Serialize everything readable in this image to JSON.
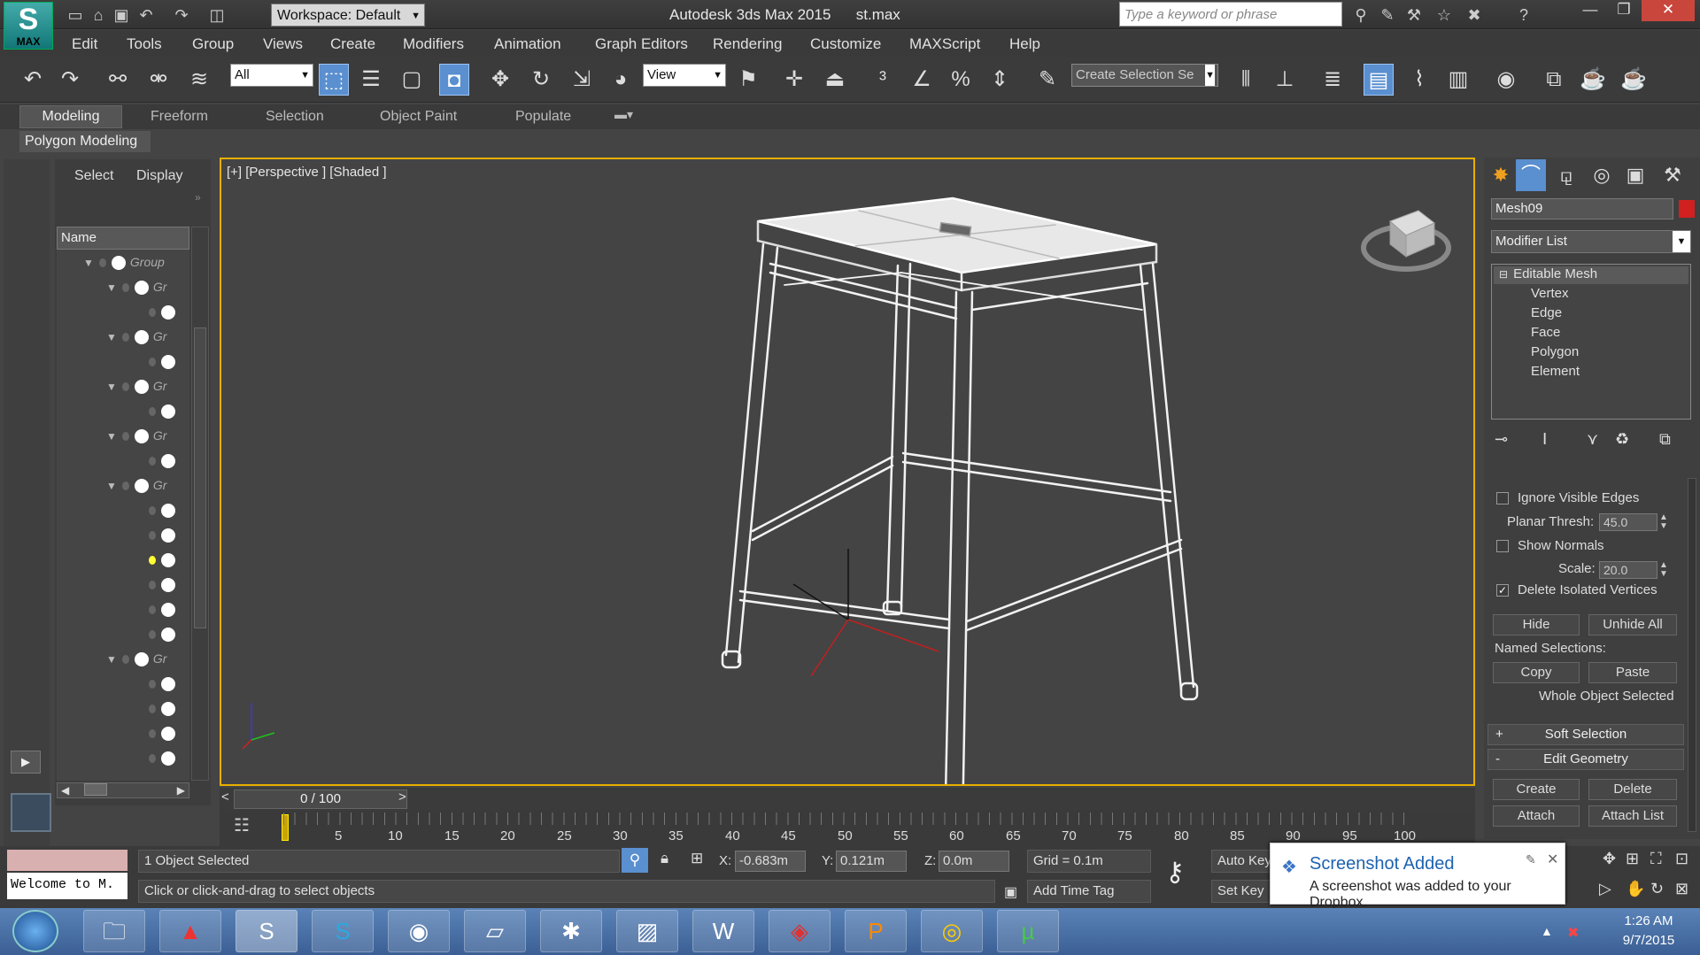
{
  "window": {
    "title": "Autodesk 3ds Max 2015",
    "file": "st.max",
    "workspace": "Workspace: Default",
    "search_placeholder": "Type a keyword or phrase",
    "logo_text": "MAX"
  },
  "menu": [
    "Edit",
    "Tools",
    "Group",
    "Views",
    "Create",
    "Modifiers",
    "Animation",
    "Graph Editors",
    "Rendering",
    "Customize",
    "MAXScript",
    "Help"
  ],
  "toolbar": {
    "filter": "All",
    "ref_coord": "View",
    "selection_set_placeholder": "Create Selection Se"
  },
  "ribbon": {
    "tabs": [
      "Modeling",
      "Freeform",
      "Selection",
      "Object Paint",
      "Populate"
    ],
    "active_tab": "Modeling",
    "panel_label": "Polygon Modeling"
  },
  "scene_explorer": {
    "tabs": [
      "Select",
      "Display"
    ],
    "column": "Name",
    "rows": [
      {
        "label": "Group",
        "level": 0
      },
      {
        "label": "Gr",
        "level": 1
      },
      {
        "label": "",
        "level": 2
      },
      {
        "label": "Gr",
        "level": 1
      },
      {
        "label": "",
        "level": 2
      },
      {
        "label": "Gr",
        "level": 1
      },
      {
        "label": "",
        "level": 2
      },
      {
        "label": "Gr",
        "level": 1
      },
      {
        "label": "",
        "level": 2
      },
      {
        "label": "Gr",
        "level": 1
      },
      {
        "label": "",
        "level": 2
      },
      {
        "label": "",
        "level": 2
      },
      {
        "label": "",
        "level": 2
      },
      {
        "label": "",
        "level": 2
      },
      {
        "label": "",
        "level": 2
      },
      {
        "label": "",
        "level": 2
      },
      {
        "label": "Gr",
        "level": 1
      },
      {
        "label": "",
        "level": 2
      },
      {
        "label": "",
        "level": 2
      },
      {
        "label": "",
        "level": 2
      },
      {
        "label": "",
        "level": 2
      }
    ]
  },
  "viewport": {
    "label": "[+] [Perspective ] [Shaded ]"
  },
  "command_panel": {
    "object_name": "Mesh09",
    "object_color": "#d02020",
    "modifier_list": "Modifier List",
    "stack": {
      "base": "Editable Mesh",
      "subs": [
        "Vertex",
        "Edge",
        "Face",
        "Polygon",
        "Element"
      ]
    },
    "ignore_visible_edges": "Ignore Visible Edges",
    "planar_thresh_label": "Planar Thresh:",
    "planar_thresh": "45.0",
    "show_normals": "Show Normals",
    "scale_label": "Scale:",
    "scale": "20.0",
    "delete_isolated": "Delete Isolated Vertices",
    "hide": "Hide",
    "unhide_all": "Unhide All",
    "named_selections": "Named Selections:",
    "copy": "Copy",
    "paste": "Paste",
    "whole_object": "Whole Object Selected",
    "soft_selection": "Soft Selection",
    "edit_geometry": "Edit Geometry",
    "create": "Create",
    "delete": "Delete",
    "attach": "Attach",
    "attach_list": "Attach List"
  },
  "timeline": {
    "frame": "0 / 100",
    "ticks": [
      "5",
      "10",
      "15",
      "20",
      "25",
      "30",
      "35",
      "40",
      "45",
      "50",
      "55",
      "60",
      "65",
      "70",
      "75",
      "80",
      "85",
      "90",
      "95",
      "100"
    ]
  },
  "status": {
    "listener": "Welcome to M.",
    "selected": "1 Object Selected",
    "prompt": "Click or click-and-drag to select objects",
    "x_label": "X:",
    "x": "-0.683m",
    "y_label": "Y:",
    "y": "0.121m",
    "z_label": "Z:",
    "z": "0.0m",
    "grid": "Grid = 0.1m",
    "add_time_tag": "Add Time Tag",
    "auto_key": "Auto Key",
    "set_key": "Set Key"
  },
  "toast": {
    "title": "Screenshot Added",
    "body": "A screenshot was added to your Dropbox."
  },
  "taskbar": {
    "time": "1:26 AM",
    "date": "9/7/2015"
  }
}
